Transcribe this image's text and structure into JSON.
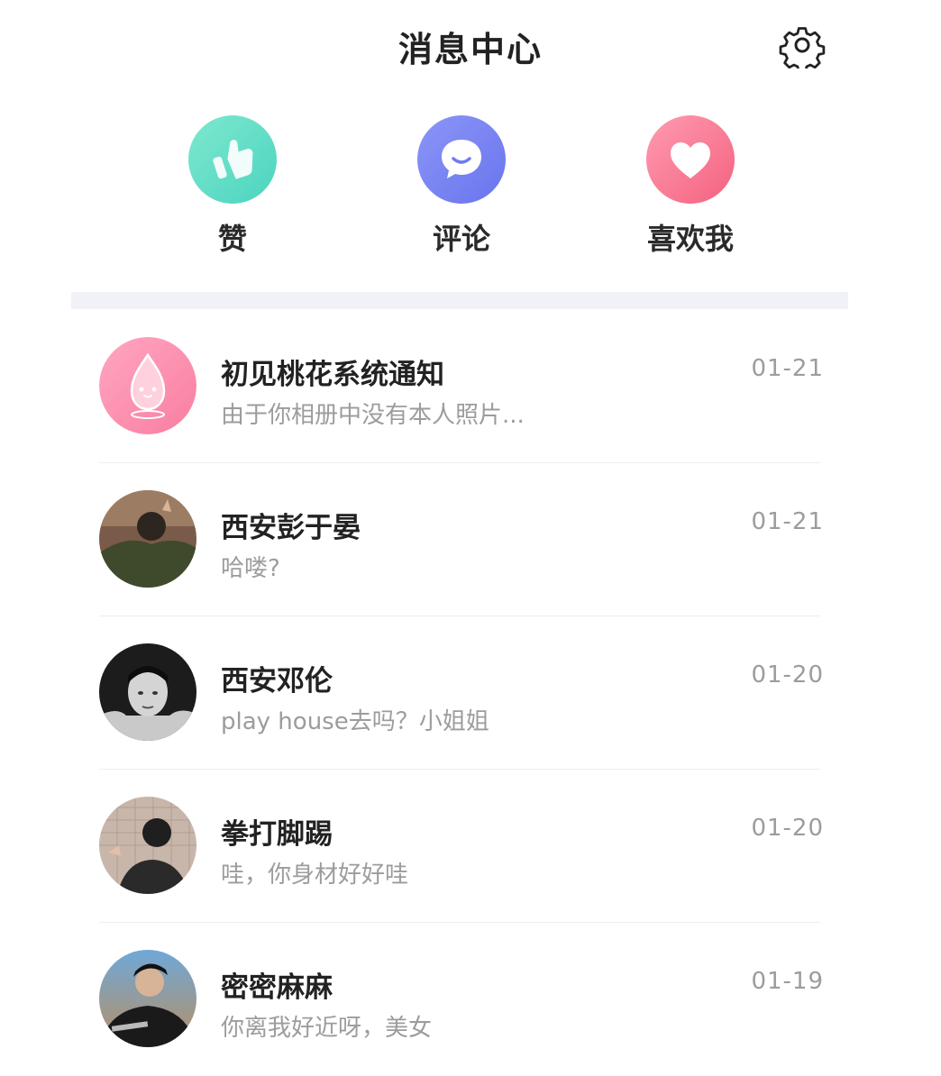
{
  "header": {
    "title": "消息中心",
    "settings_icon": "gear-icon"
  },
  "quick_actions": [
    {
      "label": "赞",
      "icon": "thumbs-up-icon",
      "color": "#5ad8c3"
    },
    {
      "label": "评论",
      "icon": "chat-bubble-icon",
      "color": "#7480f2"
    },
    {
      "label": "喜欢我",
      "icon": "heart-icon",
      "color": "#f87590"
    }
  ],
  "messages": [
    {
      "name": "初见桃花系统通知",
      "preview": "由于你相册中没有本人照片...",
      "time": "01-21",
      "avatar": "system-mascot-avatar"
    },
    {
      "name": "西安彭于晏",
      "preview": "哈喽?",
      "time": "01-21",
      "avatar": "user-avatar"
    },
    {
      "name": "西安邓伦",
      "preview": "play house去吗？小姐姐",
      "time": "01-20",
      "avatar": "user-avatar"
    },
    {
      "name": "拳打脚踢",
      "preview": "哇，你身材好好哇",
      "time": "01-20",
      "avatar": "user-avatar"
    },
    {
      "name": "密密麻麻",
      "preview": "你离我好近呀，美女",
      "time": "01-19",
      "avatar": "user-avatar"
    }
  ]
}
